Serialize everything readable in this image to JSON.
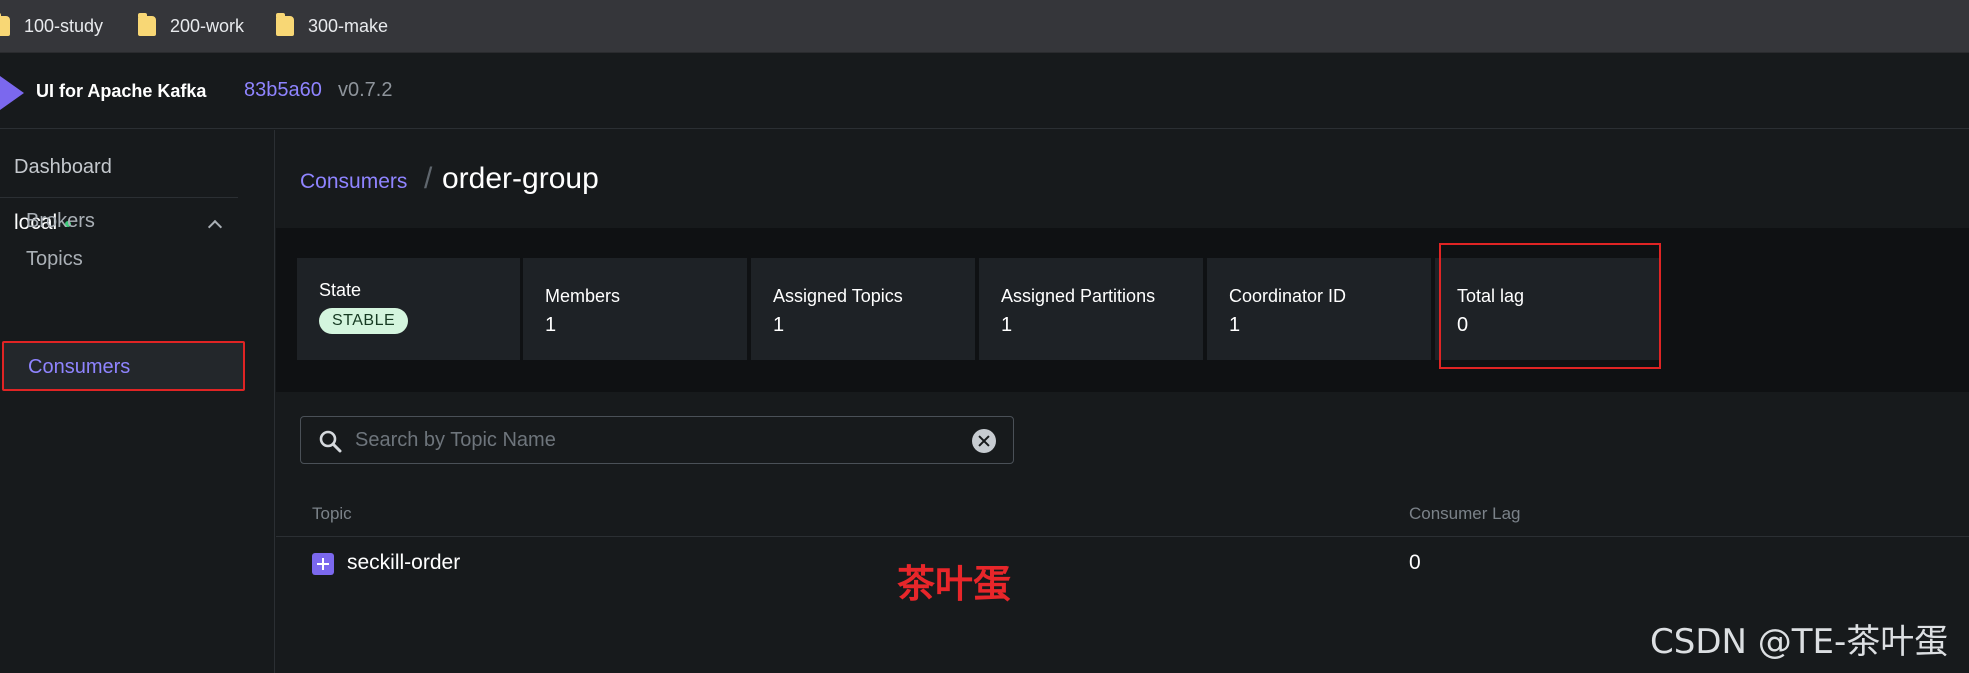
{
  "bookmarks": [
    {
      "label": "100-study"
    },
    {
      "label": "200-work"
    },
    {
      "label": "300-make"
    }
  ],
  "header": {
    "app_title": "UI for Apache Kafka",
    "version_hash": "83b5a60",
    "version": "v0.7.2"
  },
  "sidebar": {
    "dashboard": "Dashboard",
    "cluster": "local",
    "items": [
      {
        "label": "Brokers"
      },
      {
        "label": "Topics"
      },
      {
        "label": "Consumers"
      }
    ]
  },
  "breadcrumb": {
    "parent": "Consumers",
    "separator": "/",
    "current": "order-group"
  },
  "stats": {
    "state_label": "State",
    "state_value": "STABLE",
    "members_label": "Members",
    "members_value": "1",
    "assigned_topics_label": "Assigned Topics",
    "assigned_topics_value": "1",
    "assigned_partitions_label": "Assigned Partitions",
    "assigned_partitions_value": "1",
    "coordinator_id_label": "Coordinator ID",
    "coordinator_id_value": "1",
    "total_lag_label": "Total lag",
    "total_lag_value": "0"
  },
  "search": {
    "placeholder": "Search by Topic Name"
  },
  "table": {
    "columns": [
      "Topic",
      "Consumer Lag"
    ],
    "rows": [
      {
        "topic": "seckill-order",
        "lag": "0"
      }
    ]
  },
  "watermarks": {
    "center": "茶叶蛋",
    "corner": "CSDN @TE-茶叶蛋"
  },
  "colors": {
    "accent": "#8f84ff",
    "highlight": "#e02424",
    "online": "#3ec97a"
  }
}
